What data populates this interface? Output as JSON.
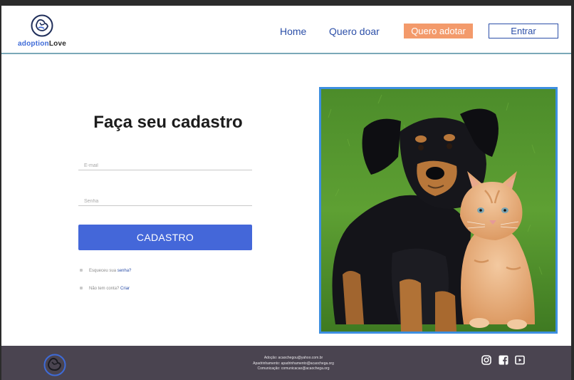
{
  "brand": {
    "name_part1": "adoption",
    "name_part2": "Love"
  },
  "nav": {
    "home": "Home",
    "donate": "Quero doar",
    "adopt": "Quero adotar",
    "login": "Entrar"
  },
  "form": {
    "title": "Faça seu cadastro",
    "email_placeholder": "E-mail",
    "password_placeholder": "Senha",
    "submit": "CADASTRO",
    "forgot_text": "Esqueceu sua ",
    "forgot_link": "senha?",
    "no_account_text": "Não tem conta? ",
    "no_account_link": "Criar"
  },
  "footer": {
    "contacts": [
      "Adoção: acaochegou@yahoo.com.br",
      "Apadrinhamento: apadrinhamento@acaochega.org",
      "Comunicação: comunicacao@acaochega.org"
    ]
  },
  "icons": {
    "logo": "dog-cat-logo-icon",
    "instagram": "instagram-icon",
    "facebook": "facebook-icon",
    "youtube": "youtube-icon"
  },
  "colors": {
    "primary": "#4467d9",
    "accent": "#f39a6b",
    "nav_text": "#2c4fa8",
    "footer_bg": "#4a4450",
    "photo_border": "#3d8fe0"
  }
}
